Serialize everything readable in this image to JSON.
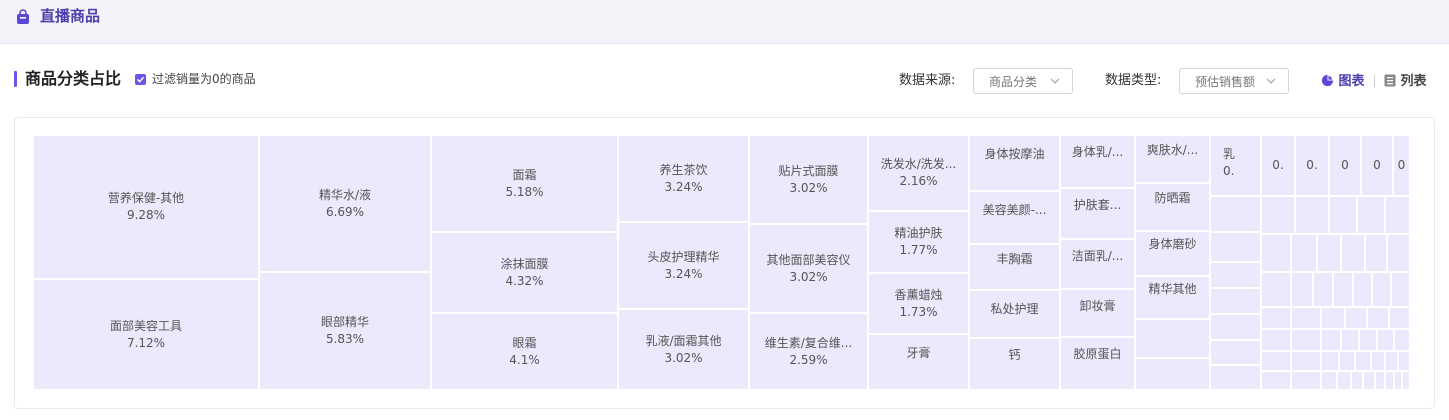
{
  "header": {
    "title": "直播商品",
    "icon": "shopping-bag-icon"
  },
  "section": {
    "title": "商品分类占比",
    "filter_checkbox": {
      "label": "过滤销量为0的商品",
      "checked": true
    },
    "data_source": {
      "label": "数据来源:",
      "value": "商品分类"
    },
    "data_type": {
      "label": "数据类型:",
      "value": "预估销售额"
    },
    "views": {
      "chart": "图表",
      "list": "列表",
      "active": "chart"
    }
  },
  "colors": {
    "accent": "#6b55e6",
    "cell": "#ece9fc",
    "title": "#4b3fb0"
  },
  "treemap": [
    {
      "name": "营养保健-其他",
      "pct": "9.28%"
    },
    {
      "name": "面部美容工具",
      "pct": "7.12%"
    },
    {
      "name": "精华水/液",
      "pct": "6.69%"
    },
    {
      "name": "眼部精华",
      "pct": "5.83%"
    },
    {
      "name": "面霜",
      "pct": "5.18%"
    },
    {
      "name": "涂抹面膜",
      "pct": "4.32%"
    },
    {
      "name": "眼霜",
      "pct": "4.1%"
    },
    {
      "name": "养生茶饮",
      "pct": "3.24%"
    },
    {
      "name": "头皮护理精华",
      "pct": "3.24%"
    },
    {
      "name": "乳液/面霜其他",
      "pct": "3.02%"
    },
    {
      "name": "贴片式面膜",
      "pct": "3.02%"
    },
    {
      "name": "其他面部美容仪",
      "pct": "3.02%"
    },
    {
      "name": "维生素/复合维...",
      "pct": "2.59%"
    },
    {
      "name": "洗发水/洗发...",
      "pct": "2.16%"
    },
    {
      "name": "精油护肤",
      "pct": "1.77%"
    },
    {
      "name": "香薰蜡烛",
      "pct": "1.73%"
    },
    {
      "name": "牙膏",
      "pct": ""
    },
    {
      "name": "身体按摩油",
      "pct": ""
    },
    {
      "name": "美容美颜-...",
      "pct": ""
    },
    {
      "name": "丰胸霜",
      "pct": ""
    },
    {
      "name": "私处护理",
      "pct": ""
    },
    {
      "name": "钙",
      "pct": ""
    },
    {
      "name": "身体乳/...",
      "pct": ""
    },
    {
      "name": "护肤套...",
      "pct": ""
    },
    {
      "name": "洁面乳/...",
      "pct": ""
    },
    {
      "name": "卸妆膏",
      "pct": ""
    },
    {
      "name": "胶原蛋白",
      "pct": ""
    },
    {
      "name": "爽肤水/...",
      "pct": ""
    },
    {
      "name": "防晒霜",
      "pct": ""
    },
    {
      "name": "身体磨砂",
      "pct": ""
    },
    {
      "name": "精华其他",
      "pct": ""
    },
    {
      "name": "乳",
      "pct": "0."
    },
    {
      "name": "",
      "pct": "0."
    },
    {
      "name": "",
      "pct": "0."
    },
    {
      "name": "",
      "pct": "0"
    },
    {
      "name": "",
      "pct": "0"
    },
    {
      "name": "",
      "pct": "0"
    }
  ]
}
